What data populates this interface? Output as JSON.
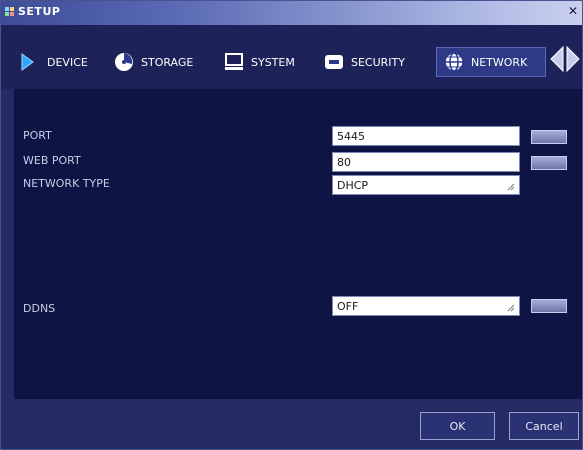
{
  "window": {
    "title": "SETUP"
  },
  "tabs": [
    {
      "label": "DEVICE",
      "icon": "device-icon"
    },
    {
      "label": "STORAGE",
      "icon": "storage-icon"
    },
    {
      "label": "SYSTEM",
      "icon": "system-icon"
    },
    {
      "label": "SECURITY",
      "icon": "security-icon"
    },
    {
      "label": "NETWORK",
      "icon": "network-icon",
      "active": true
    }
  ],
  "network": {
    "port_label": "PORT",
    "port_value": "5445",
    "web_port_label": "WEB PORT",
    "web_port_value": "80",
    "network_type_label": "NETWORK TYPE",
    "network_type_value": "DHCP",
    "ddns_label": "DDNS",
    "ddns_value": "OFF"
  },
  "footer": {
    "ok_label": "OK",
    "cancel_label": "Cancel"
  },
  "colors": {
    "accent": "#2f3a86",
    "background": "#0e1444"
  }
}
